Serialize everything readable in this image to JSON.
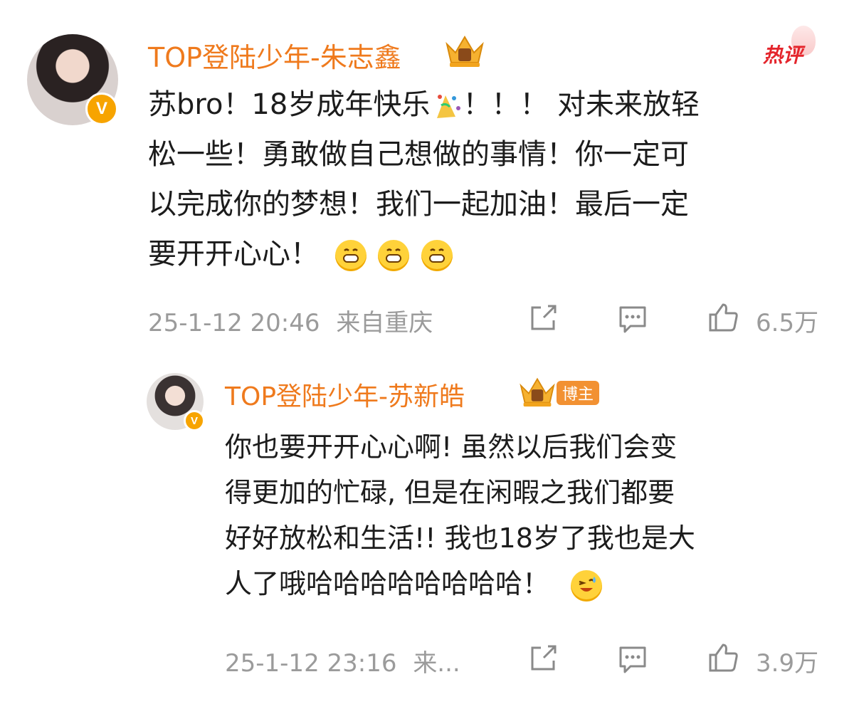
{
  "comment": {
    "username": "TOP登陆少年-朱志鑫",
    "hot_label": "热评",
    "verified": "V",
    "lines": [
      "苏bro！18岁成年快乐",
      "！！！ 对未来放轻",
      "松一些！勇敢做自己想做的事情！你一定可",
      "以完成你的梦想！我们一起加油！最后一定",
      "要开开心心！"
    ],
    "emojis": [
      "grin-emoji",
      "grin-emoji",
      "grin-emoji"
    ],
    "timestamp": "25-1-12 20:46",
    "location": "来自重庆",
    "likes": "6.5万"
  },
  "reply": {
    "username": "TOP登陆少年-苏新皓",
    "blogger_tag": "博主",
    "verified": "V",
    "lines": [
      "你也要开开心心啊! 虽然以后我们会变",
      "得更加的忙碌, 但是在闲暇之我们都要",
      "好好放松和生活!! 我也18岁了我也是大",
      "人了哦哈哈哈哈哈哈哈哈！"
    ],
    "emoji": "laugh-sweat-emoji",
    "timestamp": "25-1-12 23:16",
    "location": "来...",
    "likes": "3.9万"
  },
  "colors": {
    "username": "#ef7a1d",
    "hot": "#e4252c",
    "meta": "#9b9b9b",
    "badge": "#f7a400"
  }
}
